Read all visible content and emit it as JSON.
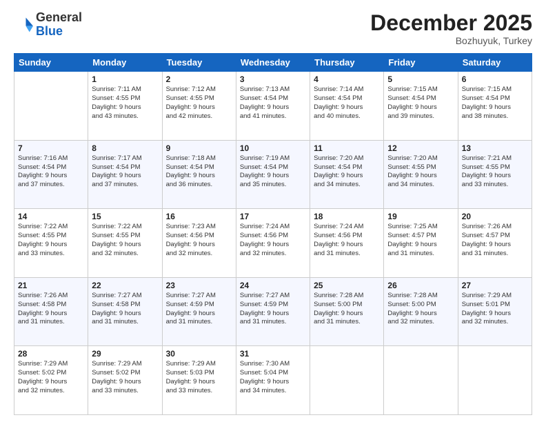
{
  "header": {
    "logo": {
      "general": "General",
      "blue": "Blue"
    },
    "title": "December 2025",
    "location": "Bozhuyuk, Turkey"
  },
  "days_of_week": [
    "Sunday",
    "Monday",
    "Tuesday",
    "Wednesday",
    "Thursday",
    "Friday",
    "Saturday"
  ],
  "weeks": [
    [
      {
        "day": "",
        "info": ""
      },
      {
        "day": "1",
        "info": "Sunrise: 7:11 AM\nSunset: 4:55 PM\nDaylight: 9 hours\nand 43 minutes."
      },
      {
        "day": "2",
        "info": "Sunrise: 7:12 AM\nSunset: 4:55 PM\nDaylight: 9 hours\nand 42 minutes."
      },
      {
        "day": "3",
        "info": "Sunrise: 7:13 AM\nSunset: 4:54 PM\nDaylight: 9 hours\nand 41 minutes."
      },
      {
        "day": "4",
        "info": "Sunrise: 7:14 AM\nSunset: 4:54 PM\nDaylight: 9 hours\nand 40 minutes."
      },
      {
        "day": "5",
        "info": "Sunrise: 7:15 AM\nSunset: 4:54 PM\nDaylight: 9 hours\nand 39 minutes."
      },
      {
        "day": "6",
        "info": "Sunrise: 7:15 AM\nSunset: 4:54 PM\nDaylight: 9 hours\nand 38 minutes."
      }
    ],
    [
      {
        "day": "7",
        "info": "Sunrise: 7:16 AM\nSunset: 4:54 PM\nDaylight: 9 hours\nand 37 minutes."
      },
      {
        "day": "8",
        "info": "Sunrise: 7:17 AM\nSunset: 4:54 PM\nDaylight: 9 hours\nand 37 minutes."
      },
      {
        "day": "9",
        "info": "Sunrise: 7:18 AM\nSunset: 4:54 PM\nDaylight: 9 hours\nand 36 minutes."
      },
      {
        "day": "10",
        "info": "Sunrise: 7:19 AM\nSunset: 4:54 PM\nDaylight: 9 hours\nand 35 minutes."
      },
      {
        "day": "11",
        "info": "Sunrise: 7:20 AM\nSunset: 4:54 PM\nDaylight: 9 hours\nand 34 minutes."
      },
      {
        "day": "12",
        "info": "Sunrise: 7:20 AM\nSunset: 4:55 PM\nDaylight: 9 hours\nand 34 minutes."
      },
      {
        "day": "13",
        "info": "Sunrise: 7:21 AM\nSunset: 4:55 PM\nDaylight: 9 hours\nand 33 minutes."
      }
    ],
    [
      {
        "day": "14",
        "info": "Sunrise: 7:22 AM\nSunset: 4:55 PM\nDaylight: 9 hours\nand 33 minutes."
      },
      {
        "day": "15",
        "info": "Sunrise: 7:22 AM\nSunset: 4:55 PM\nDaylight: 9 hours\nand 32 minutes."
      },
      {
        "day": "16",
        "info": "Sunrise: 7:23 AM\nSunset: 4:56 PM\nDaylight: 9 hours\nand 32 minutes."
      },
      {
        "day": "17",
        "info": "Sunrise: 7:24 AM\nSunset: 4:56 PM\nDaylight: 9 hours\nand 32 minutes."
      },
      {
        "day": "18",
        "info": "Sunrise: 7:24 AM\nSunset: 4:56 PM\nDaylight: 9 hours\nand 31 minutes."
      },
      {
        "day": "19",
        "info": "Sunrise: 7:25 AM\nSunset: 4:57 PM\nDaylight: 9 hours\nand 31 minutes."
      },
      {
        "day": "20",
        "info": "Sunrise: 7:26 AM\nSunset: 4:57 PM\nDaylight: 9 hours\nand 31 minutes."
      }
    ],
    [
      {
        "day": "21",
        "info": "Sunrise: 7:26 AM\nSunset: 4:58 PM\nDaylight: 9 hours\nand 31 minutes."
      },
      {
        "day": "22",
        "info": "Sunrise: 7:27 AM\nSunset: 4:58 PM\nDaylight: 9 hours\nand 31 minutes."
      },
      {
        "day": "23",
        "info": "Sunrise: 7:27 AM\nSunset: 4:59 PM\nDaylight: 9 hours\nand 31 minutes."
      },
      {
        "day": "24",
        "info": "Sunrise: 7:27 AM\nSunset: 4:59 PM\nDaylight: 9 hours\nand 31 minutes."
      },
      {
        "day": "25",
        "info": "Sunrise: 7:28 AM\nSunset: 5:00 PM\nDaylight: 9 hours\nand 31 minutes."
      },
      {
        "day": "26",
        "info": "Sunrise: 7:28 AM\nSunset: 5:00 PM\nDaylight: 9 hours\nand 32 minutes."
      },
      {
        "day": "27",
        "info": "Sunrise: 7:29 AM\nSunset: 5:01 PM\nDaylight: 9 hours\nand 32 minutes."
      }
    ],
    [
      {
        "day": "28",
        "info": "Sunrise: 7:29 AM\nSunset: 5:02 PM\nDaylight: 9 hours\nand 32 minutes."
      },
      {
        "day": "29",
        "info": "Sunrise: 7:29 AM\nSunset: 5:02 PM\nDaylight: 9 hours\nand 33 minutes."
      },
      {
        "day": "30",
        "info": "Sunrise: 7:29 AM\nSunset: 5:03 PM\nDaylight: 9 hours\nand 33 minutes."
      },
      {
        "day": "31",
        "info": "Sunrise: 7:30 AM\nSunset: 5:04 PM\nDaylight: 9 hours\nand 34 minutes."
      },
      {
        "day": "",
        "info": ""
      },
      {
        "day": "",
        "info": ""
      },
      {
        "day": "",
        "info": ""
      }
    ]
  ]
}
